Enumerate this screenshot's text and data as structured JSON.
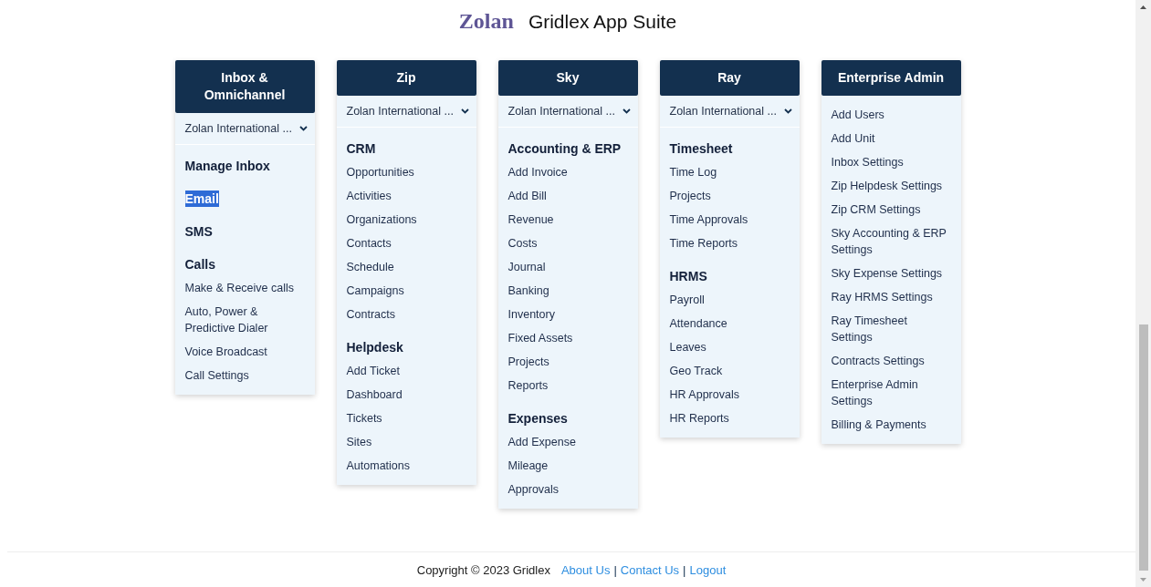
{
  "header": {
    "logo": "Zolan",
    "title": "Gridlex App Suite"
  },
  "columns": [
    {
      "title": "Inbox & Omnichannel",
      "dropdown": "Zolan International ...",
      "items": [
        {
          "kind": "heading",
          "label": "Manage Inbox",
          "highlighted": false
        },
        {
          "kind": "heading",
          "label": "Email",
          "highlighted": true
        },
        {
          "kind": "heading",
          "label": "SMS",
          "highlighted": false
        },
        {
          "kind": "heading",
          "label": "Calls",
          "highlighted": false
        },
        {
          "kind": "link",
          "label": "Make & Receive calls",
          "highlighted": false
        },
        {
          "kind": "link",
          "label": "Auto, Power & Predictive Dialer",
          "highlighted": false
        },
        {
          "kind": "link",
          "label": "Voice Broadcast",
          "highlighted": false
        },
        {
          "kind": "link",
          "label": "Call Settings",
          "highlighted": false
        }
      ]
    },
    {
      "title": "Zip",
      "dropdown": "Zolan International ...",
      "items": [
        {
          "kind": "heading",
          "label": "CRM",
          "highlighted": false
        },
        {
          "kind": "link",
          "label": "Opportunities",
          "highlighted": false
        },
        {
          "kind": "link",
          "label": "Activities",
          "highlighted": false
        },
        {
          "kind": "link",
          "label": "Organizations",
          "highlighted": false
        },
        {
          "kind": "link",
          "label": "Contacts",
          "highlighted": false
        },
        {
          "kind": "link",
          "label": "Schedule",
          "highlighted": false
        },
        {
          "kind": "link",
          "label": "Campaigns",
          "highlighted": false
        },
        {
          "kind": "link",
          "label": "Contracts",
          "highlighted": false
        },
        {
          "kind": "heading",
          "label": "Helpdesk",
          "highlighted": false
        },
        {
          "kind": "link",
          "label": "Add Ticket",
          "highlighted": false
        },
        {
          "kind": "link",
          "label": "Dashboard",
          "highlighted": false
        },
        {
          "kind": "link",
          "label": "Tickets",
          "highlighted": false
        },
        {
          "kind": "link",
          "label": "Sites",
          "highlighted": false
        },
        {
          "kind": "link",
          "label": "Automations",
          "highlighted": false
        }
      ]
    },
    {
      "title": "Sky",
      "dropdown": "Zolan International ...",
      "items": [
        {
          "kind": "heading",
          "label": "Accounting & ERP",
          "highlighted": false
        },
        {
          "kind": "link",
          "label": "Add Invoice",
          "highlighted": false
        },
        {
          "kind": "link",
          "label": "Add Bill",
          "highlighted": false
        },
        {
          "kind": "link",
          "label": "Revenue",
          "highlighted": false
        },
        {
          "kind": "link",
          "label": "Costs",
          "highlighted": false
        },
        {
          "kind": "link",
          "label": "Journal",
          "highlighted": false
        },
        {
          "kind": "link",
          "label": "Banking",
          "highlighted": false
        },
        {
          "kind": "link",
          "label": "Inventory",
          "highlighted": false
        },
        {
          "kind": "link",
          "label": "Fixed Assets",
          "highlighted": false
        },
        {
          "kind": "link",
          "label": "Projects",
          "highlighted": false
        },
        {
          "kind": "link",
          "label": "Reports",
          "highlighted": false
        },
        {
          "kind": "heading",
          "label": "Expenses",
          "highlighted": false
        },
        {
          "kind": "link",
          "label": "Add Expense",
          "highlighted": false
        },
        {
          "kind": "link",
          "label": "Mileage",
          "highlighted": false
        },
        {
          "kind": "link",
          "label": "Approvals",
          "highlighted": false
        }
      ]
    },
    {
      "title": "Ray",
      "dropdown": "Zolan International ...",
      "items": [
        {
          "kind": "heading",
          "label": "Timesheet",
          "highlighted": false
        },
        {
          "kind": "link",
          "label": "Time Log",
          "highlighted": false
        },
        {
          "kind": "link",
          "label": "Projects",
          "highlighted": false
        },
        {
          "kind": "link",
          "label": "Time Approvals",
          "highlighted": false
        },
        {
          "kind": "link",
          "label": "Time Reports",
          "highlighted": false
        },
        {
          "kind": "heading",
          "label": "HRMS",
          "highlighted": false
        },
        {
          "kind": "link",
          "label": "Payroll",
          "highlighted": false
        },
        {
          "kind": "link",
          "label": "Attendance",
          "highlighted": false
        },
        {
          "kind": "link",
          "label": "Leaves",
          "highlighted": false
        },
        {
          "kind": "link",
          "label": "Geo Track",
          "highlighted": false
        },
        {
          "kind": "link",
          "label": "HR Approvals",
          "highlighted": false
        },
        {
          "kind": "link",
          "label": "HR Reports",
          "highlighted": false
        }
      ]
    },
    {
      "title": "Enterprise Admin",
      "items": [
        {
          "kind": "link",
          "label": "Add Users",
          "highlighted": false
        },
        {
          "kind": "link",
          "label": "Add Unit",
          "highlighted": false
        },
        {
          "kind": "link",
          "label": "Inbox Settings",
          "highlighted": false
        },
        {
          "kind": "link",
          "label": "Zip Helpdesk Settings",
          "highlighted": false
        },
        {
          "kind": "link",
          "label": "Zip CRM Settings",
          "highlighted": false
        },
        {
          "kind": "link",
          "label": "Sky Accounting & ERP Settings",
          "highlighted": false
        },
        {
          "kind": "link",
          "label": "Sky Expense Settings",
          "highlighted": false
        },
        {
          "kind": "link",
          "label": "Ray HRMS Settings",
          "highlighted": false
        },
        {
          "kind": "link",
          "label": "Ray Timesheet Settings",
          "highlighted": false
        },
        {
          "kind": "link",
          "label": "Contracts Settings",
          "highlighted": false
        },
        {
          "kind": "link",
          "label": "Enterprise Admin Settings",
          "highlighted": false
        },
        {
          "kind": "link",
          "label": "Billing & Payments",
          "highlighted": false
        }
      ]
    }
  ],
  "footer": {
    "copyright": "Copyright © 2023 Gridlex",
    "links": [
      "About Us",
      "Contact Us",
      "Logout"
    ],
    "separator": "|"
  }
}
